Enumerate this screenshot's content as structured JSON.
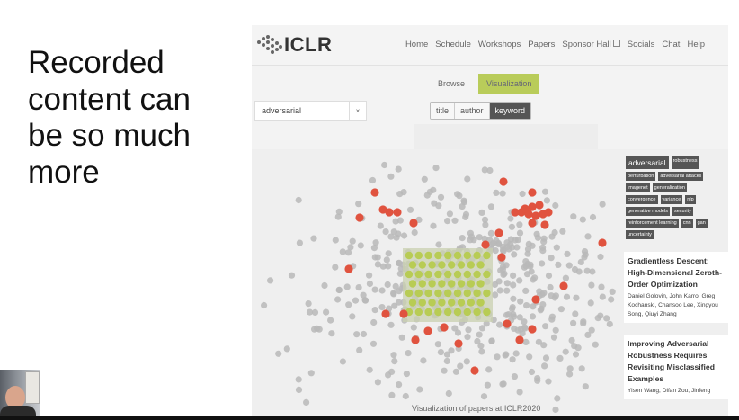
{
  "slide": {
    "lines": [
      "Recorded",
      "content can",
      "be so much",
      "more"
    ]
  },
  "site": {
    "logo_text": "ICLR",
    "nav": [
      "Home",
      "Schedule",
      "Workshops",
      "Papers",
      "Sponsor Hall",
      "Socials",
      "Chat",
      "Help"
    ]
  },
  "view_tabs": {
    "browse": "Browse",
    "visualization": "Visualization"
  },
  "search": {
    "value": "adversarial",
    "clear": "×"
  },
  "filters": {
    "title": "title",
    "author": "author",
    "keyword": "keyword"
  },
  "keywords": {
    "selected": "adversarial",
    "items": [
      "robustness",
      "perturbation",
      "adversarial attacks",
      "imagenet",
      "generalization",
      "convergence",
      "variance",
      "nlp",
      "generative models",
      "security",
      "reinforcement learning",
      "cnn",
      "gan",
      "uncertainty"
    ]
  },
  "papers": [
    {
      "title": "Gradientless Descent: High-Dimensional Zeroth-Order Optimization",
      "authors": "Daniel Golovin, John Karro, Greg Kochanski, Chansoo Lee, Xingyou Song, Qiuyi Zhang"
    },
    {
      "title": "Improving Adversarial Robustness Requires Revisiting Misclassified Examples",
      "authors": "Yisen Wang, Difan Zou, Jinfeng"
    }
  ],
  "caption": "Visualization of papers at ICLR2020",
  "colors": {
    "highlight": "#e0533f",
    "selection": "#b8cc54",
    "point": "#b9b9b9"
  }
}
